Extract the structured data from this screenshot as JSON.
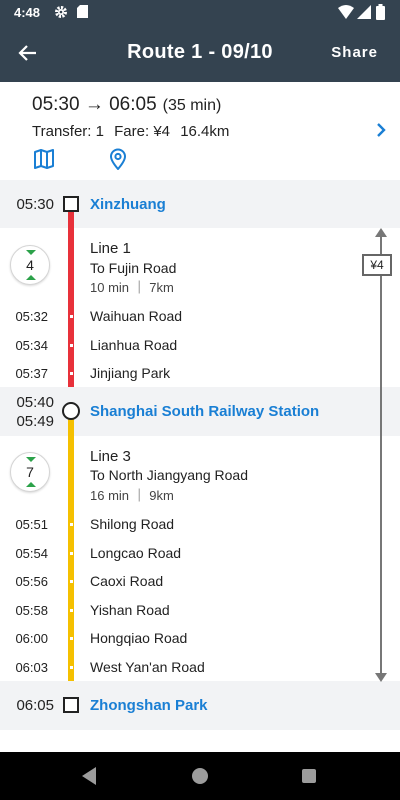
{
  "status_bar": {
    "time": "4:48"
  },
  "app_bar": {
    "title": "Route 1 - 09/10",
    "share_label": "Share"
  },
  "summary": {
    "times": "05:30 → 06:05",
    "duration": "(35 min)",
    "transfer": "Transfer: 1",
    "fare": "Fare: ¥4",
    "distance": "16.4km"
  },
  "colors": {
    "line1": "#e8313a",
    "line3": "#f5c000",
    "accent": "#1a7fd4",
    "header": "#344350"
  },
  "stations": [
    {
      "time": "05:30",
      "name": "Xinzhuang"
    },
    {
      "time_arrive": "05:40",
      "time_depart": "05:49",
      "name": "Shanghai South Railway Station"
    },
    {
      "time": "06:05",
      "name": "Zhongshan Park"
    }
  ],
  "segments": [
    {
      "stops_count": "4",
      "line": "Line 1",
      "direction": "To Fujin Road",
      "info": "10 min ｜ 7km",
      "stops": [
        {
          "time": "05:32",
          "name": "Waihuan Road"
        },
        {
          "time": "05:34",
          "name": "Lianhua Road"
        },
        {
          "time": "05:37",
          "name": "Jinjiang Park"
        }
      ]
    },
    {
      "stops_count": "7",
      "line": "Line 3",
      "direction": "To North Jiangyang Road",
      "info": "16 min ｜ 9km",
      "stops": [
        {
          "time": "05:51",
          "name": "Shilong Road"
        },
        {
          "time": "05:54",
          "name": "Longcao Road"
        },
        {
          "time": "05:56",
          "name": "Caoxi Road"
        },
        {
          "time": "05:58",
          "name": "Yishan Road"
        },
        {
          "time": "06:00",
          "name": "Hongqiao Road"
        },
        {
          "time": "06:03",
          "name": "West Yan'an Road"
        }
      ]
    }
  ],
  "fare_marker": "¥4"
}
